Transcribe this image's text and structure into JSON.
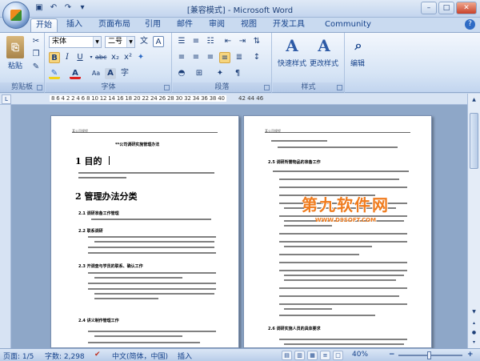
{
  "window": {
    "title": "[兼容模式] - Microsoft Word"
  },
  "tabs": [
    "开始",
    "插入",
    "页面布局",
    "引用",
    "邮件",
    "审阅",
    "视图",
    "开发工具",
    "Community Clips"
  ],
  "ribbon": {
    "clipboard": {
      "label": "剪贴板",
      "paste": "粘贴"
    },
    "font": {
      "label": "字体",
      "font_name": "宋体",
      "font_size": "二号"
    },
    "paragraph": {
      "label": "段落"
    },
    "styles": {
      "label": "样式",
      "quick_styles": "快速样式",
      "change_styles": "更改样式"
    },
    "editing": {
      "label": "编辑"
    }
  },
  "ruler": {
    "ticks": "8 6 4 2 2 4 6 8 10 12 14 16 18 20 22 24 26 28 30 32 34 36 38 40",
    "ticks_right": "42 44 46"
  },
  "page1": {
    "header": "某公司规程",
    "doc_title": "**公司调研实施管理办法",
    "h1_purpose": "1 目的",
    "h1_class": "2 管理办法分类",
    "h2_1": "2.1 调研准备工作管理",
    "h2_2": "2.2 联系调研",
    "h2_3": "2.3 开调查与学员的联系、确认工作",
    "h2_4": "2.4 讲义制作管理工作"
  },
  "page2": {
    "header": "某公司规程",
    "h2_5": "2.5 调研所需物品的准备工作",
    "h2_6": "2.6 调研实施人员的具体要求"
  },
  "watermark": {
    "line1": "第九软件网",
    "line2": "WWW.D9SOFT.COM"
  },
  "status": {
    "page": "页面: 1/5",
    "words": "字数: 2,298",
    "lang": "中文(简体，中国)",
    "mode": "插入",
    "zoom": "40%"
  }
}
